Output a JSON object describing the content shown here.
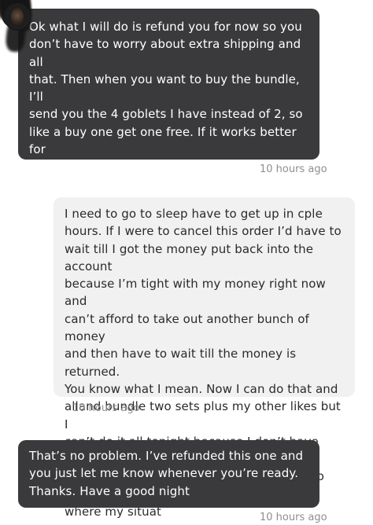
{
  "messages": [
    {
      "text": "Ok what I will do is refund you for now so you\ndon’t have to worry about extra shipping and all\nthat. Then when you want to buy the bundle, I’ll\nsend you the 4 goblets I have instead of 2, so\nlike a buy one get one free. If it works better for\nyou we can wait till the weekend to do the bun-\ndle. Just send me a message when you are ready\nand we can make that deal",
      "time": "10 hours ago"
    },
    {
      "text": "I need to go to sleep have to get up in cple\nhours. If I were to cancel this order I’d have to\nwait till I got the money put back into the account\nbecause I’m tight with my money right now and\ncan’t afford to take out another bunch of money\nand then have to wait till the money is returned.\nYou know what I mean. Now I can do that and\nalland bundle two sets plus my other likes but I\ncan’t do it all tonight because I don’t have funds\nright now. I have to wait till the weekend to see\nwhere my situat",
      "time": "10 hours ago"
    },
    {
      "text": "That’s no problem. I’ve refunded this one and\nyou just let me know whenever you’re ready.\nThanks. Have a good night",
      "time": "10 hours ago"
    }
  ]
}
